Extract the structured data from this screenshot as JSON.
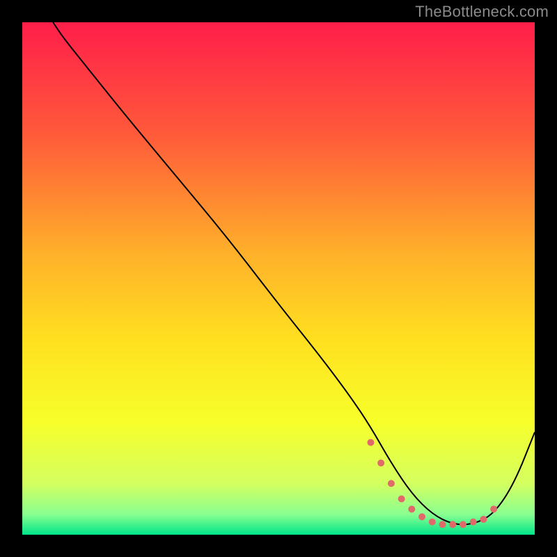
{
  "watermark": "TheBottleneck.com",
  "chart_data": {
    "type": "line",
    "title": "",
    "xlabel": "",
    "ylabel": "",
    "xlim": [
      0,
      100
    ],
    "ylim": [
      0,
      100
    ],
    "grid": false,
    "background_gradient_stops": [
      {
        "offset": 0,
        "color": "#ff1e4a"
      },
      {
        "offset": 22,
        "color": "#ff5a3a"
      },
      {
        "offset": 45,
        "color": "#ffb02a"
      },
      {
        "offset": 62,
        "color": "#ffe020"
      },
      {
        "offset": 78,
        "color": "#f7ff2a"
      },
      {
        "offset": 90,
        "color": "#d4ff60"
      },
      {
        "offset": 96,
        "color": "#8aff90"
      },
      {
        "offset": 100,
        "color": "#00e58a"
      }
    ],
    "series": [
      {
        "name": "bottleneck-curve",
        "color": "#000000",
        "stroke_width": 2,
        "x": [
          6,
          8,
          12,
          20,
          30,
          40,
          50,
          58,
          64,
          68,
          72,
          76,
          80,
          84,
          88,
          92,
          96,
          100
        ],
        "y": [
          100,
          97,
          92,
          82,
          70,
          58,
          45,
          35,
          27,
          21,
          14,
          8,
          4,
          2,
          2,
          4,
          10,
          20
        ]
      }
    ],
    "highlight_points": {
      "name": "optimal-range",
      "color": "#e06a6a",
      "radius": 5,
      "x": [
        68,
        70,
        72,
        74,
        76,
        78,
        80,
        82,
        84,
        86,
        88,
        90,
        92
      ],
      "y": [
        18,
        14,
        10,
        7,
        5,
        3.5,
        2.5,
        2,
        2,
        2,
        2.5,
        3,
        5
      ]
    }
  }
}
